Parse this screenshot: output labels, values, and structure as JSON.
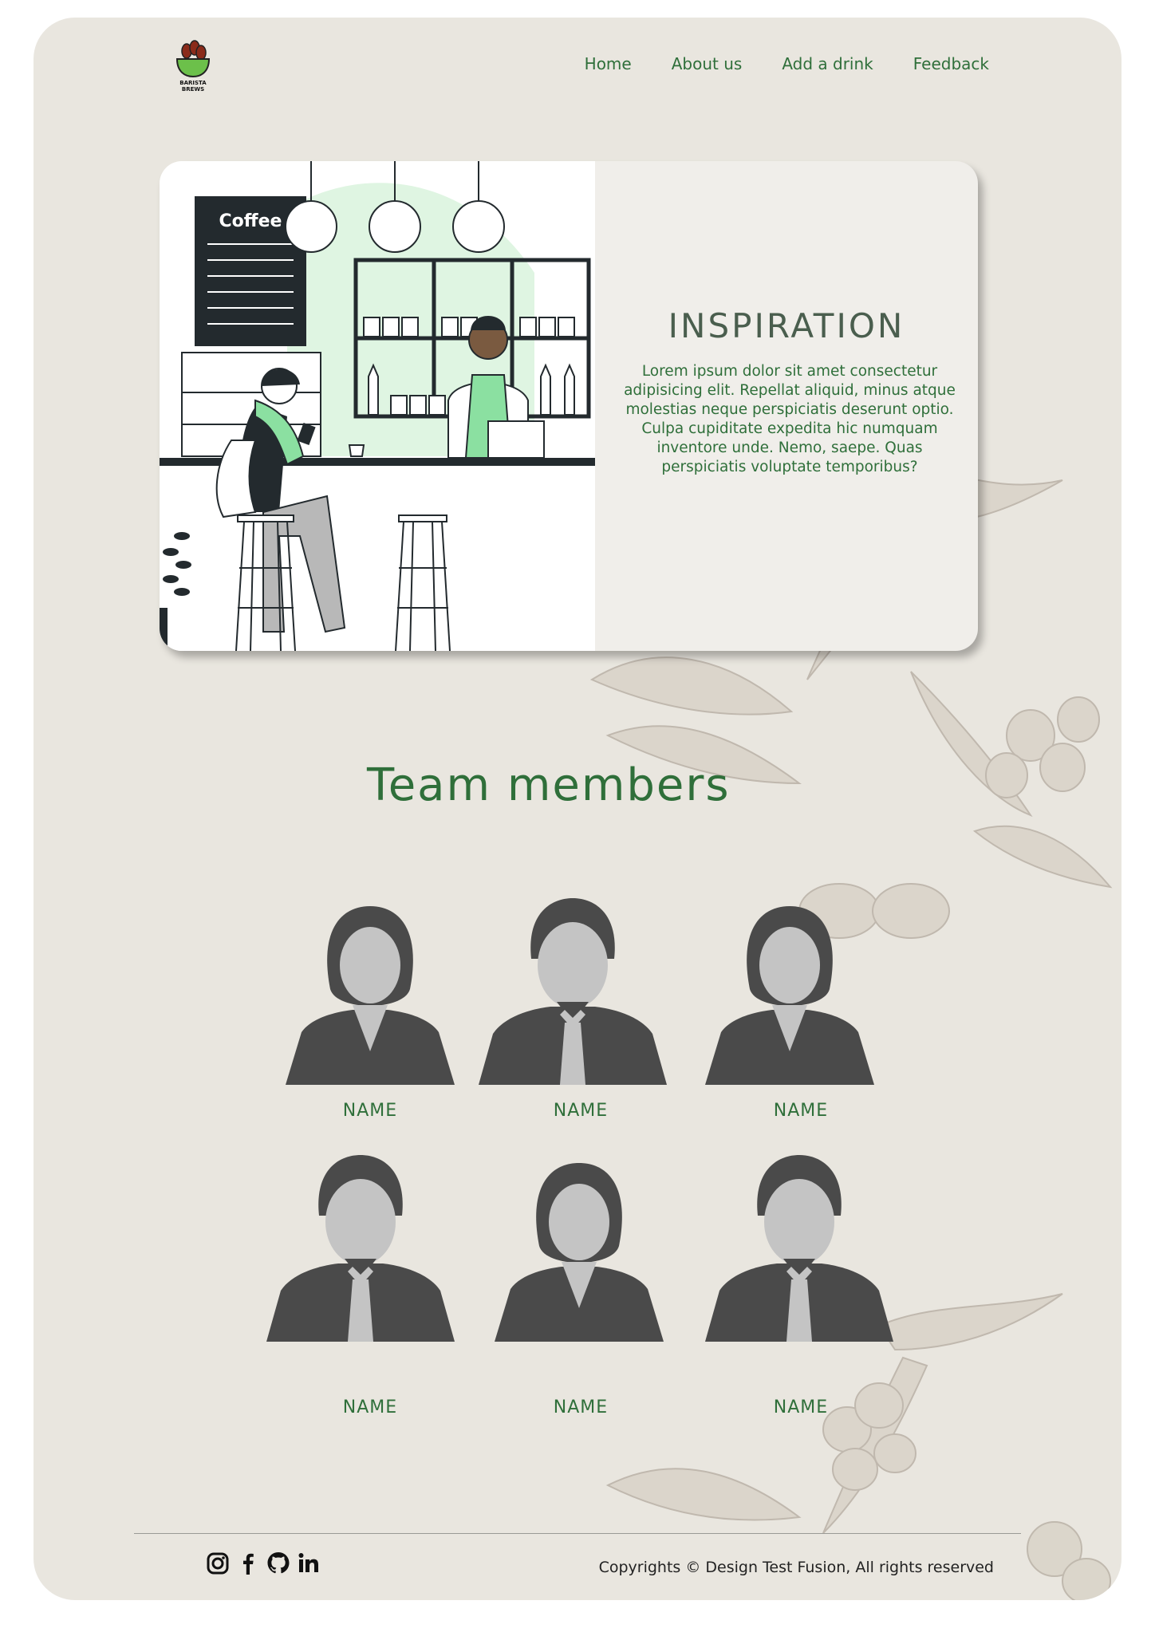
{
  "header": {
    "logo_text_1": "BARISTA",
    "logo_text_2": "BREWS",
    "nav": [
      {
        "label": "Home"
      },
      {
        "label": "About us"
      },
      {
        "label": "Add a drink"
      },
      {
        "label": "Feedback"
      }
    ]
  },
  "hero": {
    "menu_board_title": "Coffee",
    "title": "INSPIRATION",
    "body": "Lorem ipsum dolor sit amet consectetur adipisicing elit. Repellat aliquid, minus atque molestias neque perspiciatis deserunt optio. Culpa cupiditate expedita hic numquam inventore unde. Nemo, saepe. Quas perspiciatis voluptate temporibus?"
  },
  "team": {
    "title": "Team members",
    "members": [
      {
        "name": "NAME",
        "avatar": "female-avatar-icon"
      },
      {
        "name": "NAME",
        "avatar": "male-avatar-icon"
      },
      {
        "name": "NAME",
        "avatar": "female-avatar-icon"
      },
      {
        "name": "NAME",
        "avatar": "male-avatar-icon"
      },
      {
        "name": "NAME",
        "avatar": "female-avatar-icon"
      },
      {
        "name": "NAME",
        "avatar": "male-avatar-icon"
      }
    ]
  },
  "footer": {
    "socials": [
      "instagram-icon",
      "facebook-icon",
      "github-icon",
      "linkedin-icon"
    ],
    "copyright": "Copyrights © Design Test Fusion, All rights reserved"
  },
  "colors": {
    "page_background": "#e9e6df",
    "accent_green": "#2f6f3a",
    "light_green": "#dff5e2",
    "avatar_dark": "#4a4a4a",
    "avatar_light": "#c4c4c4"
  }
}
